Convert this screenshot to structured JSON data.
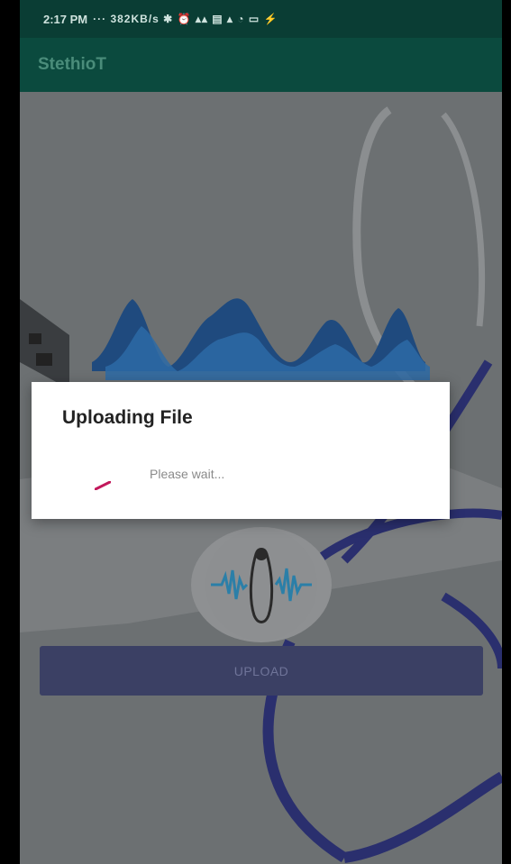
{
  "statusbar": {
    "time": "2:17 PM",
    "indicators": "··· 382KB/s ✱ ⏰ ▴▴ ▤ ▴ ◔ ▭ ⚡"
  },
  "appbar": {
    "title": "StethioT"
  },
  "main": {
    "upload_label": "UPLOAD"
  },
  "dialog": {
    "title": "Uploading File",
    "message": "Please wait..."
  },
  "colors": {
    "statusbar": "#0a3d34",
    "appbar": "#0b4a3e",
    "button": "#3b4064",
    "dialog": "#ffffff",
    "spinner": "#c2185b"
  },
  "icons": {
    "logo": "stethoscope-sound-wave-icon",
    "spinner": "progress-spinner-icon"
  }
}
